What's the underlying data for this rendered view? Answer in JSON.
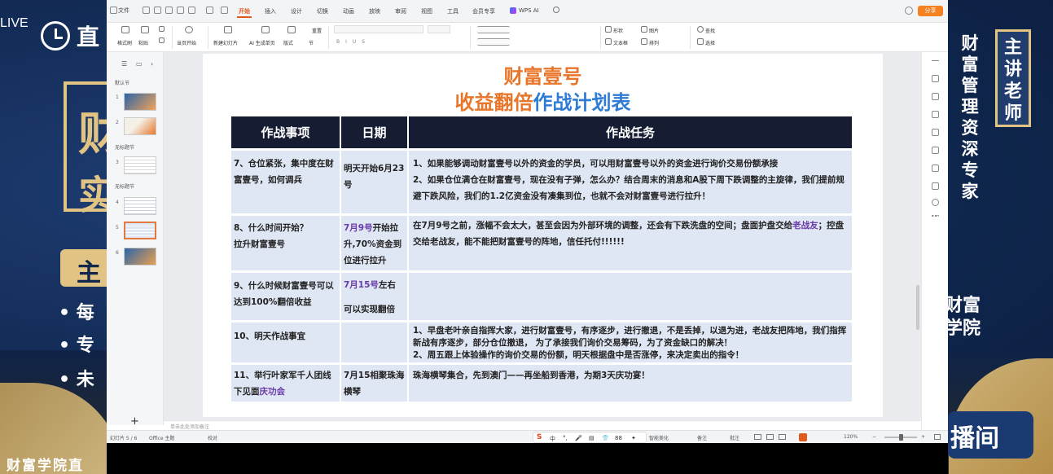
{
  "backdrop": {
    "live_tag": "LIVE",
    "top_left_text": "直",
    "left_big_char1": "财",
    "left_big_char2": "实",
    "left_pill_char": "主",
    "bullets": [
      "• 每",
      "• 专",
      "• 未"
    ],
    "footer_left": "财富学院直",
    "right_vertical": "财富管理资深专家",
    "teacher_badge": "主讲老师",
    "right_mid": "财富\n学院",
    "live_room": "播间"
  },
  "wps": {
    "file_menu": "文件",
    "tabs": [
      "开始",
      "插入",
      "设计",
      "切换",
      "动画",
      "放映",
      "审阅",
      "视图",
      "工具",
      "会员专享",
      "WPS AI"
    ],
    "active_tab": "开始",
    "share_label": "分享",
    "ribbon": {
      "format_painter": "格式刷",
      "paste": "粘贴",
      "from_current": "当页开始",
      "new_slide": "新建幻灯片",
      "ai_generate": "AI 生成单页",
      "layout": "版式",
      "section": "节",
      "reset": "重置",
      "shape": "形状",
      "picture": "图片",
      "textbox": "文本框",
      "arrange": "排列",
      "find": "查找",
      "select": "选择"
    },
    "slide_panel": {
      "sections": [
        "默认节",
        "无标题节",
        "无标题节"
      ],
      "slide_numbers": [
        "1",
        "2",
        "3",
        "4",
        "5",
        "6"
      ],
      "active_slide": 5,
      "add_symbol": "+"
    },
    "slide": {
      "title_line1": "财富壹号",
      "title_line2_a": "收益翻倍",
      "title_line2_b": "作战计划表",
      "headers": [
        "作战事项",
        "日期",
        "作战任务"
      ],
      "rows": [
        {
          "item": "7、仓位紧张，集中度在财富壹号，如何调兵",
          "date_hl": "",
          "date": "明天开始6月23号",
          "task_hl": "",
          "task_prefix": "",
          "task": "1、如果能够调动财富壹号以外的资金的学员，可以用财富壹号以外的资金进行询价交易份额承接\n2、如果仓位满仓在财富壹号，现在没有子弹，怎么办？结合周末的消息和A股下周下跌调整的主旋律，我们提前规避下跌风险，我们的1.2亿资金没有凑集到位，也就不会对财富壹号进行拉升！"
        },
        {
          "item": "8、什么时间开始？\n拉升财富壹号",
          "date_hl": "7月9号",
          "date": "开始拉升,70%资金到位进行拉升",
          "task_prefix": "在7月9号之前，涨幅不会太大，甚至会因为外部环境的调整，还会有下跌洗盘的空间；盘面护盘交给",
          "task_hl": "老战友",
          "task": "；控盘交给老战友，能不能把财富壹号的阵地，信任托付!!!!!!"
        },
        {
          "item": "9、什么时候财富壹号可以达到100%翻倍收益",
          "date_hl": "7月15号",
          "date": "左右\n可以实现翻倍",
          "task_hl": "",
          "task_prefix": "",
          "task": ""
        },
        {
          "item": "10、明天作战事宜",
          "date_hl": "",
          "date": "",
          "task_hl": "",
          "task_prefix": "",
          "task": "1、早盘老叶亲自指挥大家，进行财富壹号，有序逐步，进行撤退，不是丢掉，以退为进，老战友把阵地，我们指挥新战有序逐步，部分仓位撤退， 为了承接我们询价交易筹码，为了资金缺口的解决！\n2、周五跟上体验操作的询价交易的份额，明天根据盘中是否涨停，来决定卖出的指令！"
        },
        {
          "item_prefix": "11、举行叶家军千人团线下见面",
          "item_hl": "庆功会",
          "date_hl": "",
          "date": "7月15相聚珠海横琴",
          "task_hl": "",
          "task_prefix": "",
          "task": "珠海横琴集合，先到澳门——再坐船到香港，为期3天庆功宴！"
        }
      ]
    },
    "notes_placeholder": "单击此处添加备注",
    "status": {
      "slide_counter": "幻灯片 5 / 6",
      "theme": "Office 主题",
      "proofing": "校对",
      "smart_beautify": "智能美化",
      "notes": "备注",
      "comments": "批注",
      "zoom": "120%"
    },
    "ime": {
      "logo": "S",
      "items": [
        "中",
        "°,",
        "🎤",
        "▤",
        "👕",
        "88",
        "✦"
      ]
    },
    "colors": {
      "accent": "#e05a1e",
      "table_header": "#161d33",
      "table_cell": "#dfe6f4",
      "title_orange": "#e8762a",
      "title_blue": "#2f7cd6",
      "highlight_purple": "#6a3aa8"
    }
  }
}
